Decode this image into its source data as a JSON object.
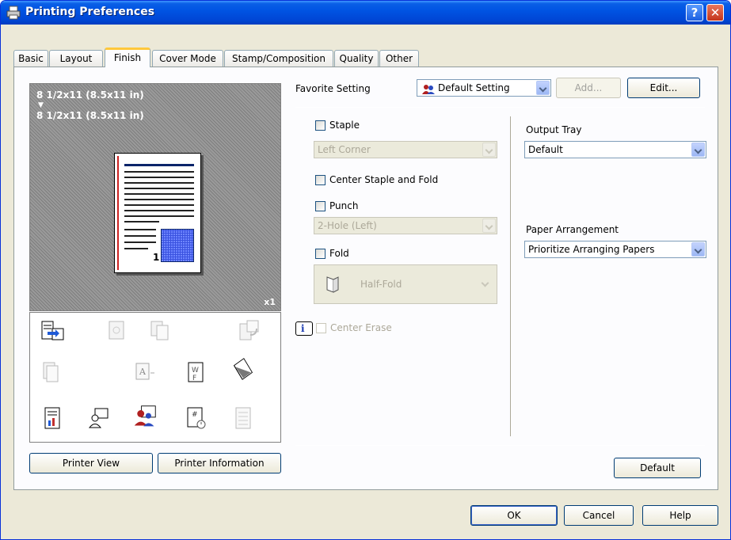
{
  "window": {
    "title": "Printing Preferences",
    "help_btn": "?",
    "close_btn": "✕"
  },
  "tabs": [
    {
      "label": "Basic"
    },
    {
      "label": "Layout"
    },
    {
      "label": "Finish"
    },
    {
      "label": "Cover Mode"
    },
    {
      "label": "Stamp/Composition"
    },
    {
      "label": "Quality"
    },
    {
      "label": "Other"
    }
  ],
  "preview": {
    "line1": "8 1/2x11 (8.5x11 in)",
    "arrow": "▼",
    "line2": "8 1/2x11 (8.5x11 in)",
    "page_number": "1",
    "copies": "x1"
  },
  "left_buttons": {
    "printer_view": "Printer View",
    "printer_information": "Printer Information"
  },
  "favorite": {
    "label": "Favorite Setting",
    "value": "Default Setting",
    "add": "Add...",
    "edit": "Edit..."
  },
  "finish": {
    "staple_label": "Staple",
    "staple_position": "Left Corner",
    "center_staple_fold_label": "Center Staple and Fold",
    "punch_label": "Punch",
    "punch_value": "2-Hole (Left)",
    "fold_label": "Fold",
    "fold_value": "Half-Fold",
    "center_erase_label": "Center Erase"
  },
  "output": {
    "output_tray_label": "Output Tray",
    "output_tray_value": "Default",
    "paper_arrangement_label": "Paper Arrangement",
    "paper_arrangement_value": "Prioritize Arranging Papers"
  },
  "panel_default_btn": "Default",
  "dialog_buttons": {
    "ok": "OK",
    "cancel": "Cancel",
    "help": "Help"
  },
  "colors": {
    "title_bar": "#0054e3",
    "dialog_bg": "#ece9d8",
    "tab_highlight": "#ffc83c"
  }
}
